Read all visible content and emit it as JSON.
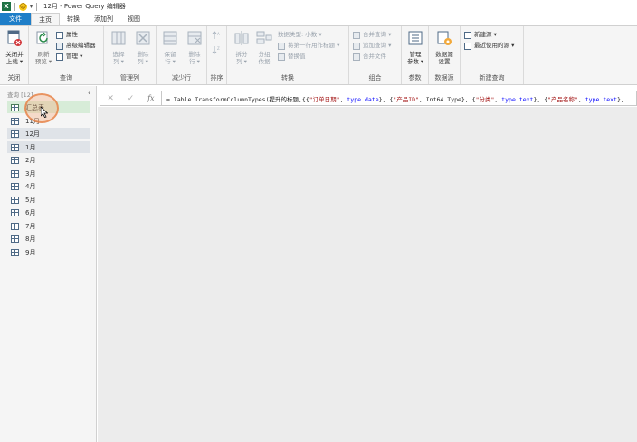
{
  "window": {
    "title": "12月 - Power Query 编辑器",
    "app_icon": "X",
    "quick_access": "▾"
  },
  "tabs": [
    {
      "label": "文件"
    },
    {
      "label": "主页"
    },
    {
      "label": "转换"
    },
    {
      "label": "添加列"
    },
    {
      "label": "视图"
    }
  ],
  "ribbon": {
    "close_group": {
      "label": "关闭",
      "close_load": "关闭并",
      "close_load2": "上载 ▾"
    },
    "query_group": {
      "label": "查询",
      "refresh": "刷新",
      "refresh2": "预览 ▾",
      "properties": "属性",
      "advanced_editor": "高级编辑器",
      "manage": "管理 ▾"
    },
    "manage_cols_group": {
      "label": "管理列",
      "choose": "选择",
      "choose2": "列 ▾",
      "remove": "删除",
      "remove2": "列 ▾"
    },
    "reduce_rows_group": {
      "label": "减少行",
      "keep": "保留",
      "keep2": "行 ▾",
      "delete": "删除",
      "delete2": "行 ▾"
    },
    "sort_group": {
      "label": "排序"
    },
    "transform_group": {
      "label": "转换",
      "split": "拆分",
      "split2": "列 ▾",
      "group_by": "分组",
      "group_by2": "依据",
      "data_type": "数据类型: 小数 ▾",
      "first_row_header": "将第一行用作标题 ▾",
      "replace": "替换值"
    },
    "combine_group": {
      "label": "组合",
      "merge": "合并查询 ▾",
      "append": "追加查询 ▾",
      "merge_files": "合并文件"
    },
    "params_group": {
      "label": "参数",
      "manage_params": "管理",
      "manage_params2": "参数 ▾"
    },
    "datasource_group": {
      "label": "数据源",
      "settings": "数据源",
      "settings2": "设置"
    },
    "newquery_group": {
      "label": "新建查询",
      "new_source": "新建源 ▾",
      "recent_source": "最近使用的源 ▾"
    }
  },
  "queries": {
    "header": "查询 [12]",
    "collapse": "‹",
    "items": [
      {
        "label": "汇总表"
      },
      {
        "label": "11月"
      },
      {
        "label": "12月"
      },
      {
        "label": "1月"
      },
      {
        "label": "2月"
      },
      {
        "label": "3月"
      },
      {
        "label": "4月"
      },
      {
        "label": "5月"
      },
      {
        "label": "6月"
      },
      {
        "label": "7月"
      },
      {
        "label": "8月"
      },
      {
        "label": "9月"
      }
    ]
  },
  "formula_bar": {
    "cancel": "✕",
    "confirm": "✓",
    "fx": "fx",
    "p1": "= Table.TransformColumnTypes(提升的标题,{{",
    "s1": "\"订单日期\"",
    "p2": ", ",
    "k1": "type date",
    "p3": "}, {",
    "s2": "\"产品ID\"",
    "p4": ", Int64.Type}, {",
    "s3": "\"分类\"",
    "p5": ", ",
    "k2": "type text",
    "p6": "}, {",
    "s4": "\"产品名称\"",
    "p7": ", ",
    "k3": "type text",
    "p8": "},"
  },
  "colors": {
    "file_tab": "#1e7ec8",
    "excel_green": "#1f7244"
  }
}
